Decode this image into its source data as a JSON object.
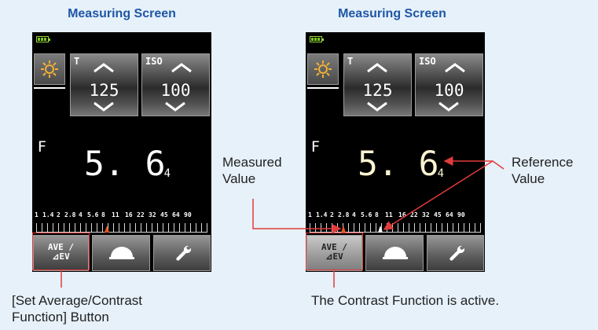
{
  "left": {
    "title": "Measuring Screen",
    "t_tag": "T",
    "t_value": "125",
    "iso_tag": "ISO",
    "iso_value": "100",
    "f_label": "F",
    "f_main": "5. 6",
    "f_sub": "4",
    "ave_line1": "AVE /",
    "ave_line2": "⊿EV",
    "caption_line1": "[Set Average/Contrast",
    "caption_line2": "Function] Button"
  },
  "right": {
    "title": "Measuring Screen",
    "t_tag": "T",
    "t_value": "125",
    "iso_tag": "ISO",
    "iso_value": "100",
    "f_label": "F",
    "f_main": "5. 6",
    "f_sub": "4",
    "ave_line1": "AVE /",
    "ave_line2": "⊿EV",
    "caption": "The Contrast Function is active."
  },
  "scale_labels": [
    "1",
    "1.4",
    "2",
    "2.8",
    "4",
    "5.6",
    "8",
    "11",
    "16",
    "22",
    "32",
    "45",
    "64",
    "90"
  ],
  "callouts": {
    "measured_line1": "Measured",
    "measured_line2": "Value",
    "reference_line1": "Reference",
    "reference_line2": "Value"
  },
  "colors": {
    "background": "#e6f1fa",
    "title": "#1f56a5",
    "callout_red": "#e23b3b",
    "marker_orange": "#e6561e",
    "reference_value": "#fbf3d0"
  },
  "icons": [
    "battery-icon",
    "sun-icon",
    "up-arrow-icon",
    "down-arrow-icon",
    "dome-icon",
    "wrench-icon"
  ]
}
